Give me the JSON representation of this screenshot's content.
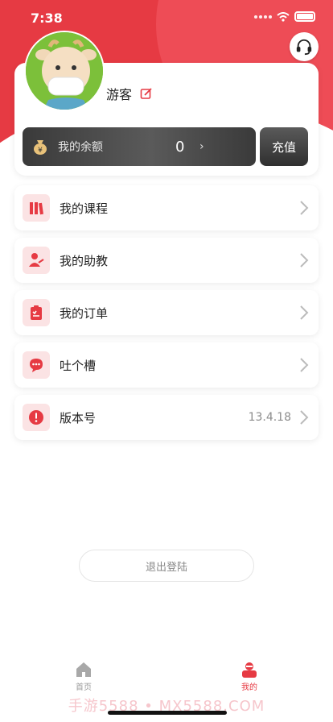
{
  "status_bar": {
    "time": "7:38"
  },
  "profile": {
    "username": "游客"
  },
  "balance": {
    "label": "我的余额",
    "value": "0",
    "recharge_label": "充值"
  },
  "menu": [
    {
      "label": "我的课程",
      "icon": "books-icon"
    },
    {
      "label": "我的助教",
      "icon": "assistant-icon"
    },
    {
      "label": "我的订单",
      "icon": "order-icon"
    },
    {
      "label": "吐个槽",
      "icon": "chat-icon"
    },
    {
      "label": "版本号",
      "icon": "info-icon",
      "value": "13.4.18"
    }
  ],
  "logout_label": "退出登陆",
  "tabbar": {
    "home_label": "首页",
    "mine_label": "我的"
  },
  "watermark": "手游5588 • MX5588.COM",
  "colors": {
    "accent": "#e63a43",
    "balance_bar": "#3a3a3a"
  }
}
